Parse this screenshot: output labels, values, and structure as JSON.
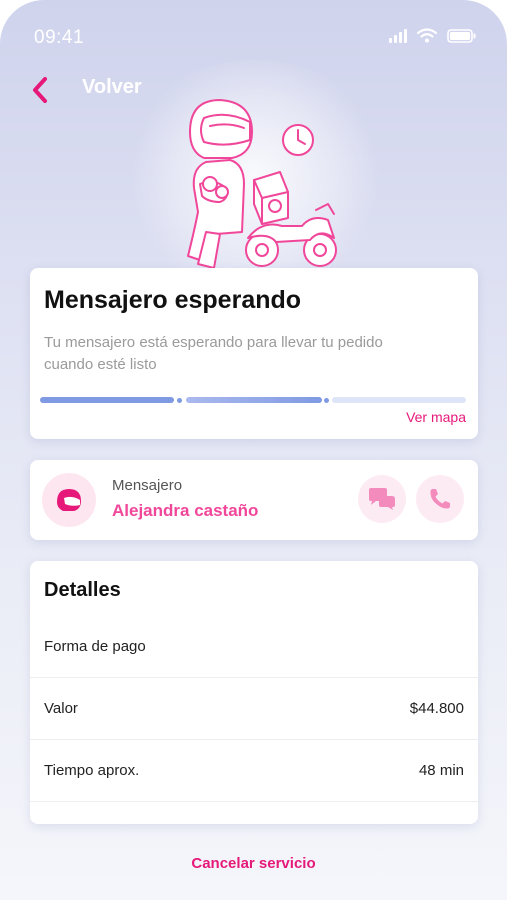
{
  "status_bar": {
    "time": "09:41"
  },
  "header": {
    "back_label": "Volver"
  },
  "status_card": {
    "title": "Mensajero esperando",
    "description": "Tu mensajero está esperando para llevar tu pedido cuando esté listo",
    "map_link": "Ver mapa",
    "progress_steps_completed": 2,
    "progress_steps_total": 3
  },
  "courier": {
    "role": "Mensajero",
    "name": "Alejandra castaño"
  },
  "details": {
    "title": "Detalles",
    "rows": [
      {
        "label": "Forma de pago",
        "value": ""
      },
      {
        "label": "Valor",
        "value": "$44.800"
      },
      {
        "label": "Tiempo aprox.",
        "value": "48 min"
      }
    ]
  },
  "cancel_label": "Cancelar servicio",
  "colors": {
    "accent": "#e6197a",
    "accent_soft": "#f0479a",
    "progress": "#7f9ae3"
  },
  "icons": [
    "back-chevron-icon",
    "signal-icon",
    "wifi-icon",
    "battery-icon",
    "helmet-icon",
    "chat-icon",
    "phone-icon"
  ]
}
